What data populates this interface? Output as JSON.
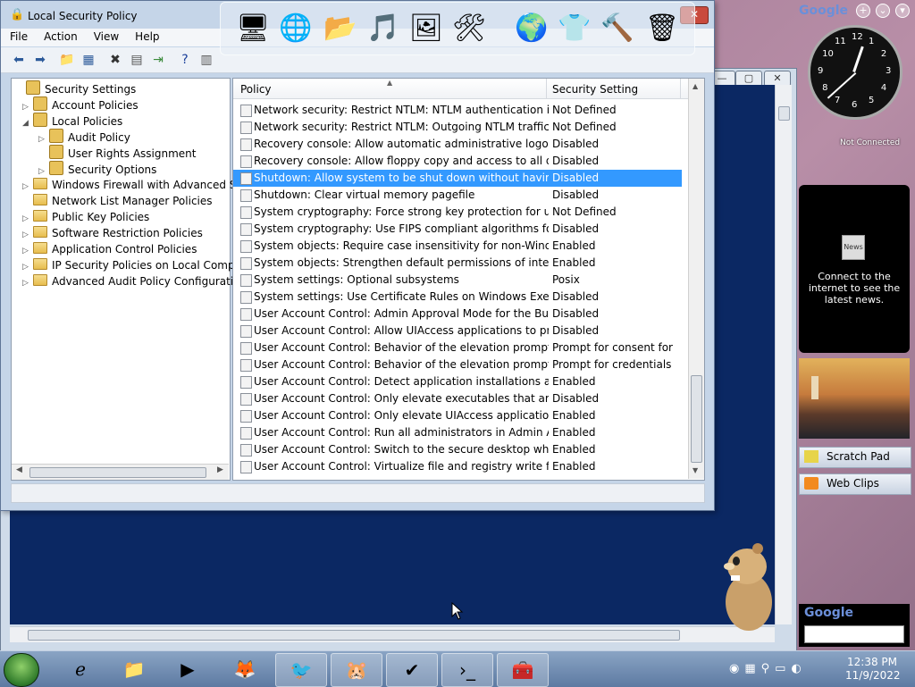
{
  "window": {
    "title": "Local Security Policy",
    "close": "✕"
  },
  "menu": [
    "File",
    "Action",
    "View",
    "Help"
  ],
  "toolbar_icons": [
    "back-icon",
    "forward-icon",
    "up-folder-icon",
    "show-hide-tree-icon",
    "delete-icon",
    "properties-icon",
    "export-icon",
    "help-icon",
    "extended-view-icon"
  ],
  "tree": [
    {
      "label": "Security Settings",
      "level": 0,
      "expander": ""
    },
    {
      "label": "Account Policies",
      "level": 1,
      "expander": "▷"
    },
    {
      "label": "Local Policies",
      "level": 1,
      "expander": "◢"
    },
    {
      "label": "Audit Policy",
      "level": 2,
      "expander": "▷"
    },
    {
      "label": "User Rights Assignment",
      "level": 2,
      "expander": ""
    },
    {
      "label": "Security Options",
      "level": 2,
      "expander": "▷"
    },
    {
      "label": "Windows Firewall with Advanced Secu",
      "level": 1,
      "expander": "▷"
    },
    {
      "label": "Network List Manager Policies",
      "level": 1,
      "expander": ""
    },
    {
      "label": "Public Key Policies",
      "level": 1,
      "expander": "▷"
    },
    {
      "label": "Software Restriction Policies",
      "level": 1,
      "expander": "▷"
    },
    {
      "label": "Application Control Policies",
      "level": 1,
      "expander": "▷"
    },
    {
      "label": "IP Security Policies on Local Compute",
      "level": 1,
      "expander": "▷"
    },
    {
      "label": "Advanced Audit Policy Configuration",
      "level": 1,
      "expander": "▷"
    }
  ],
  "columns": {
    "policy": "Policy",
    "setting": "Security Setting"
  },
  "rows": [
    {
      "policy": "Network security: Restrict NTLM: NTLM authentication in th...",
      "setting": "Not Defined"
    },
    {
      "policy": "Network security: Restrict NTLM: Outgoing NTLM traffic to ...",
      "setting": "Not Defined"
    },
    {
      "policy": "Recovery console: Allow automatic administrative logon",
      "setting": "Disabled"
    },
    {
      "policy": "Recovery console: Allow floppy copy and access to all drives...",
      "setting": "Disabled"
    },
    {
      "policy": "Shutdown: Allow system to be shut down without having to...",
      "setting": "Disabled"
    },
    {
      "policy": "Shutdown: Clear virtual memory pagefile",
      "setting": "Disabled"
    },
    {
      "policy": "System cryptography: Force strong key protection for user k...",
      "setting": "Not Defined"
    },
    {
      "policy": "System cryptography: Use FIPS compliant algorithms for en...",
      "setting": "Disabled"
    },
    {
      "policy": "System objects: Require case insensitivity for non-Windows ...",
      "setting": "Enabled"
    },
    {
      "policy": "System objects: Strengthen default permissions of internal s...",
      "setting": "Enabled"
    },
    {
      "policy": "System settings: Optional subsystems",
      "setting": "Posix"
    },
    {
      "policy": "System settings: Use Certificate Rules on Windows Executabl...",
      "setting": "Disabled"
    },
    {
      "policy": "User Account Control: Admin Approval Mode for the Built-i...",
      "setting": "Disabled"
    },
    {
      "policy": "User Account Control: Allow UIAccess applications to prom...",
      "setting": "Disabled"
    },
    {
      "policy": "User Account Control: Behavior of the elevation prompt for ...",
      "setting": "Prompt for consent for ..."
    },
    {
      "policy": "User Account Control: Behavior of the elevation prompt for ...",
      "setting": "Prompt for credentials"
    },
    {
      "policy": "User Account Control: Detect application installations and p...",
      "setting": "Enabled"
    },
    {
      "policy": "User Account Control: Only elevate executables that are sign...",
      "setting": "Disabled"
    },
    {
      "policy": "User Account Control: Only elevate UIAccess applications th...",
      "setting": "Enabled"
    },
    {
      "policy": "User Account Control: Run all administrators in Admin Appr...",
      "setting": "Enabled"
    },
    {
      "policy": "User Account Control: Switch to the secure desktop when pr...",
      "setting": "Enabled"
    },
    {
      "policy": "User Account Control: Virtualize file and registry write failure...",
      "setting": "Enabled"
    }
  ],
  "selected_row": 4,
  "sidebar": {
    "google": "Google",
    "clock_numbers": [
      "12",
      "1",
      "2",
      "3",
      "4",
      "5",
      "6",
      "7",
      "8",
      "9",
      "10",
      "11"
    ],
    "not_connected": "Not Connected",
    "news_msg": "Connect to the internet to see the latest news.",
    "scratch_pad": "Scratch Pad",
    "web_clips": "Web Clips",
    "search_logo": "Google"
  },
  "clock": {
    "hour": 12,
    "minute": 38
  },
  "taskbar": {
    "time": "12:38 PM",
    "date": "11/9/2022"
  },
  "colors": {
    "selection": "#3399ff",
    "desktop": "#0b2863"
  }
}
